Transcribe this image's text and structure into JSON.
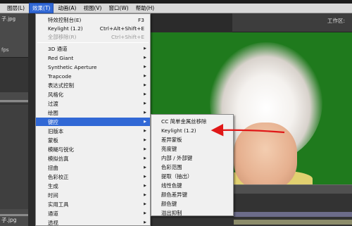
{
  "menubar": {
    "items": [
      {
        "label": "图层(L)"
      },
      {
        "label": "效果(T)",
        "active": true
      },
      {
        "label": "动画(A)"
      },
      {
        "label": "视图(V)"
      },
      {
        "label": "窗口(W)"
      },
      {
        "label": "帮助(H)"
      }
    ]
  },
  "left_panel": {
    "file_top": "子.jpg",
    "fps": "fps",
    "file_bottom": "子.jpg"
  },
  "workspace_label": "工作区:",
  "effect_menu": {
    "top_items": [
      {
        "label": "特效控制台(E)",
        "shortcut": "F3"
      },
      {
        "label": "Keylight (1.2)",
        "shortcut": "Ctrl+Alt+Shift+E"
      },
      {
        "label": "全部移除(R)",
        "shortcut": "Ctrl+Shift+E",
        "disabled": true
      }
    ],
    "categories": [
      {
        "label": "3D 通道"
      },
      {
        "label": "Red Giant"
      },
      {
        "label": "Synthetic Aperture"
      },
      {
        "label": "Trapcode"
      },
      {
        "label": "表达式控制"
      },
      {
        "label": "风格化"
      },
      {
        "label": "过渡"
      },
      {
        "label": "绘图"
      },
      {
        "label": "键控",
        "hover": true
      },
      {
        "label": "旧版本"
      },
      {
        "label": "蒙板"
      },
      {
        "label": "模糊与锐化"
      },
      {
        "label": "模拟仿真"
      },
      {
        "label": "扭曲"
      },
      {
        "label": "色彩校正"
      },
      {
        "label": "生成"
      },
      {
        "label": "时间"
      },
      {
        "label": "实用工具"
      },
      {
        "label": "通道"
      },
      {
        "label": "透视"
      }
    ]
  },
  "keying_submenu": {
    "items": [
      {
        "label": "CC 简单金属丝移除"
      },
      {
        "label": "Keylight (1.2)"
      },
      {
        "label": "差异蒙板"
      },
      {
        "label": "亮度键"
      },
      {
        "label": "内部 / 外部键"
      },
      {
        "label": "色彩范围"
      },
      {
        "label": "提取（抽出）"
      },
      {
        "label": "线性色键"
      },
      {
        "label": "颜色差异键"
      },
      {
        "label": "颜色键"
      },
      {
        "label": "溢出抑制"
      }
    ]
  },
  "colors": {
    "menu_highlight": "#3168d5",
    "green_screen": "#1f7a1d",
    "annotation_arrow": "#e01818"
  },
  "icons": {
    "submenu_arrow": "arrow-right-icon"
  }
}
